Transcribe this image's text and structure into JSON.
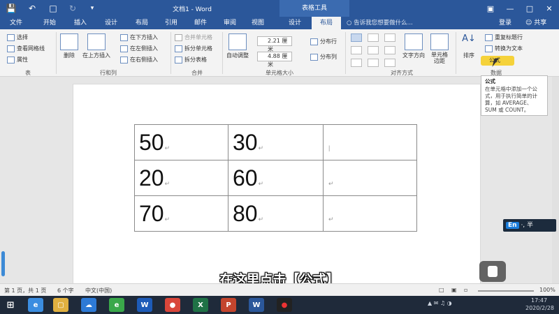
{
  "app": {
    "doc_title": "文档1 - Word",
    "context_tools": "表格工具"
  },
  "tabs": [
    "文件",
    "开始",
    "插入",
    "设计",
    "布局",
    "引用",
    "邮件",
    "审阅",
    "视图",
    "设计",
    "布局"
  ],
  "active_tab_index": 10,
  "tell_me": "告诉我您想要做什么...",
  "account": {
    "login": "登录",
    "share": "共享"
  },
  "ribbon": {
    "table": {
      "select": "选择",
      "gridlines": "查看网格线",
      "properties": "属性",
      "group": "表"
    },
    "rows_cols": {
      "delete": "删除",
      "insert_above": "在上方插入",
      "insert_below": "在下方插入",
      "insert_left": "在左侧插入",
      "insert_right": "在右侧插入",
      "group": "行和列"
    },
    "merge": {
      "merge_cells": "合并单元格",
      "split_cells": "拆分单元格",
      "split_table": "拆分表格",
      "group": "合并"
    },
    "cell_size": {
      "autofit": "自动调整",
      "height": "2.21 厘米",
      "width": "4.88 厘米",
      "dist_rows": "分布行",
      "dist_cols": "分布列",
      "group": "单元格大小"
    },
    "alignment": {
      "text_direction": "文字方向",
      "margins": "单元格边距",
      "group": "对齐方式"
    },
    "data": {
      "sort": "排序",
      "repeat_header": "重复标题行",
      "convert": "转换为文本",
      "formula": "公式",
      "group": "数据"
    }
  },
  "tooltip": {
    "title": "公式",
    "body": "在单元格中添加一个公式，用于执行简单的计算，如 AVERAGE、SUM 或 COUNT。"
  },
  "table": [
    [
      "50",
      "30",
      ""
    ],
    [
      "20",
      "60",
      ""
    ],
    [
      "70",
      "80",
      ""
    ]
  ],
  "status": {
    "page": "第 1 页，共 1 页",
    "words": "6 个字",
    "lang": "中文(中国)",
    "zoom": "100%"
  },
  "caption": "在这里点击【公式】",
  "ime": {
    "en": "En",
    "rest": "·, 半"
  },
  "taskbar": {
    "icons": [
      "ie-icon",
      "folder-icon",
      "baidu-cloud-icon",
      "360-browser-icon",
      "wps-icon",
      "chrome-icon",
      "excel-icon",
      "powerpoint-icon",
      "word-icon",
      "record-icon"
    ],
    "time": "17:47",
    "date": "2020/2/28"
  },
  "colors": {
    "word_blue": "#2b579a",
    "highlight": "#f5d23a",
    "taskbar": "#1f2a3a"
  }
}
